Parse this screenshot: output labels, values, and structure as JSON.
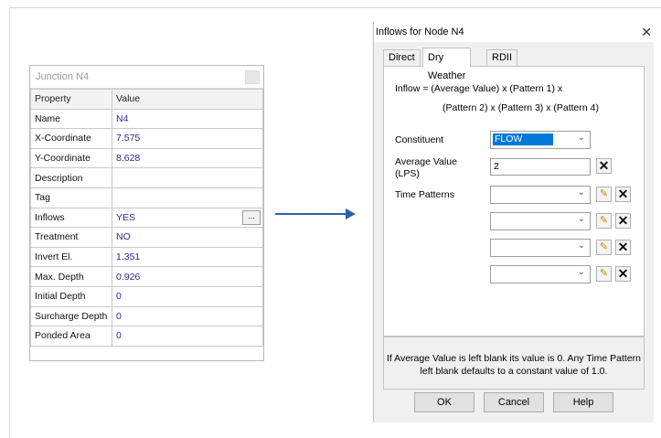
{
  "props_panel": {
    "title": "Junction N4",
    "header": {
      "property": "Property",
      "value": "Value"
    },
    "rows": [
      {
        "key": "Name",
        "value": "N4"
      },
      {
        "key": "X-Coordinate",
        "value": "7.575"
      },
      {
        "key": "Y-Coordinate",
        "value": "8.628"
      },
      {
        "key": "Description",
        "value": ""
      },
      {
        "key": "Tag",
        "value": ""
      },
      {
        "key": "Inflows",
        "value": "YES"
      },
      {
        "key": "Treatment",
        "value": "NO"
      },
      {
        "key": "Invert El.",
        "value": "1.351"
      },
      {
        "key": "Max. Depth",
        "value": "0.926"
      },
      {
        "key": "Initial Depth",
        "value": "0"
      },
      {
        "key": "Surcharge Depth",
        "value": "0"
      },
      {
        "key": "Ponded Area",
        "value": "0"
      }
    ],
    "ellipsis": "..."
  },
  "dialog": {
    "title": "Inflows for Node N4",
    "close": "✕",
    "tabs": [
      "Direct",
      "Dry Weather",
      "RDII"
    ],
    "active_tab": "Dry Weather",
    "formula_line1": "Inflow = (Average Value) x (Pattern 1) x",
    "formula_line2": "(Pattern 2) x (Pattern 3) x (Pattern 4)",
    "constituent_label": "Constituent",
    "constituent_value": "FLOW",
    "avg_label_1": "Average Value",
    "avg_label_2": "(LPS)",
    "avg_value": "2",
    "time_patterns_label": "Time Patterns",
    "info_line1": "If Average Value is left blank its value is 0. Any Time Pattern",
    "info_line2": "left blank defaults to a constant value of 1.0.",
    "buttons": {
      "ok": "OK",
      "cancel": "Cancel",
      "help": "Help"
    }
  },
  "colors": {
    "arrow": "#2f5fa6",
    "selection": "#0078d7",
    "value_text": "#2a2a9a"
  }
}
